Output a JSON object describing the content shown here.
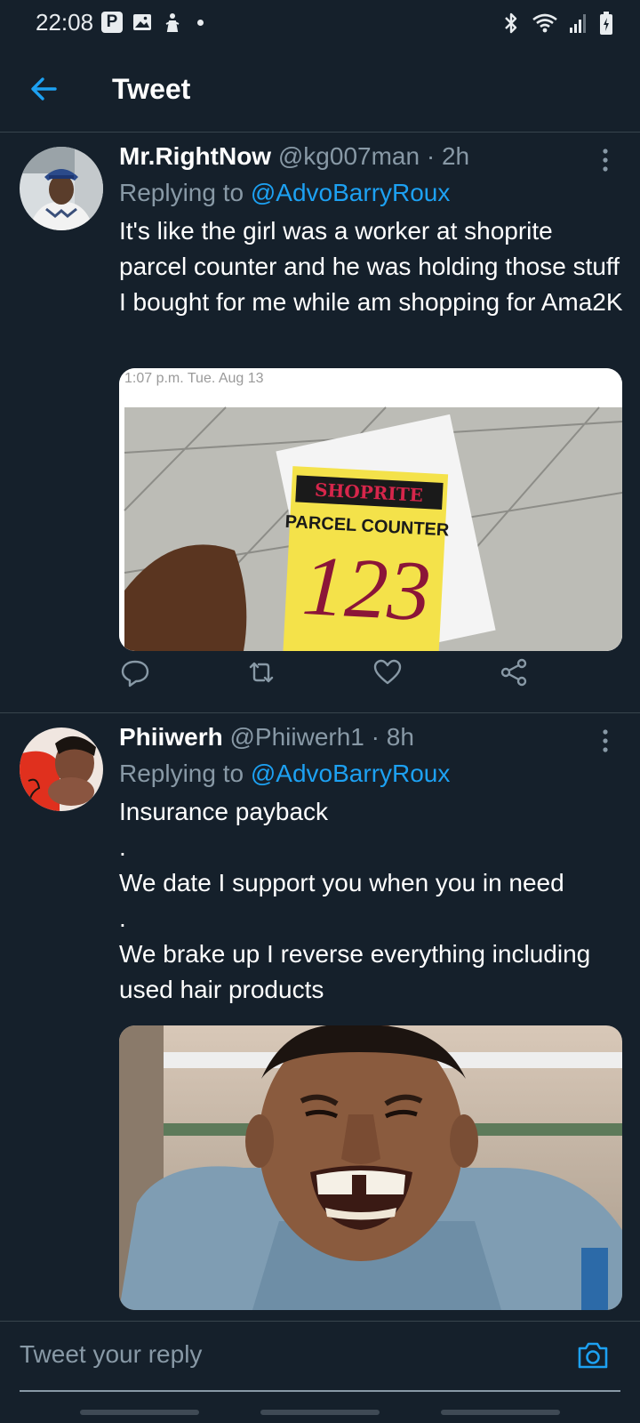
{
  "status_bar": {
    "time": "22:08",
    "p_badge": "P",
    "icons": [
      "parking-icon",
      "gallery-icon",
      "notification-icon",
      "bluetooth-icon",
      "wifi-icon",
      "signal-icon",
      "battery-icon"
    ]
  },
  "header": {
    "title": "Tweet",
    "back_icon": "arrow-left-icon"
  },
  "tweets": [
    {
      "name": "Mr.RightNow",
      "meta": " @kg007man · 2h",
      "replying_prefix": "Replying to ",
      "replying_to": "@AdvoBarryRoux",
      "text": "It's like the girl was a worker at shoprite parcel counter and he was holding those stuff I bought for me while am shopping for Ama2K",
      "media": {
        "timestamp": "1:07 p.m. Tue. Aug 13",
        "brand": "SHOPRITE",
        "card_label": "PARCEL COUNTER",
        "card_number": "123"
      }
    },
    {
      "name": "Phiiwerh",
      "meta": " @Phiiwerh1 · 8h",
      "replying_prefix": "Replying to ",
      "replying_to": "@AdvoBarryRoux",
      "text_lines": [
        "Insurance payback",
        ".",
        "We date I support you when you in need",
        ".",
        "We brake up I reverse everything including  used hair products"
      ]
    }
  ],
  "actions": [
    "reply-icon",
    "retweet-icon",
    "like-icon",
    "share-icon"
  ],
  "reply_bar": {
    "placeholder": "Tweet your reply",
    "camera_icon": "camera-icon"
  },
  "colors": {
    "background": "#15202b",
    "accent": "#1da1f2",
    "muted": "#8899a6",
    "divider": "#38444d"
  }
}
